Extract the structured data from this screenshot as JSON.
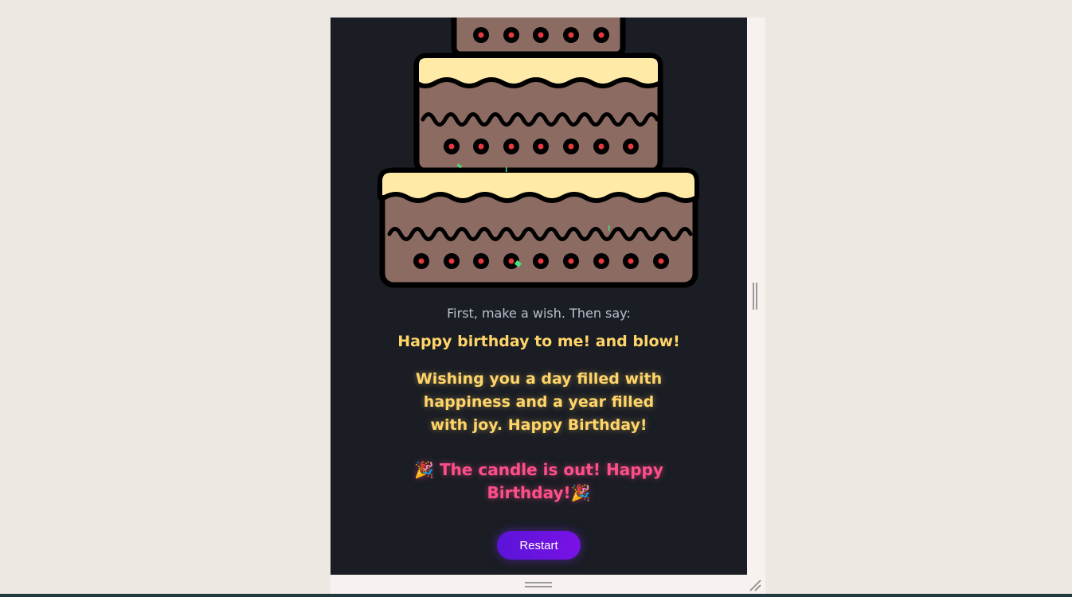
{
  "card": {
    "prompt": "First, make a wish. Then say:",
    "phrase": "Happy birthday to me! and blow!",
    "message": "Wishing you a day filled with happiness and a year filled with joy. Happy Birthday!",
    "status": "🎉 The candle is out! Happy Birthday!🎉",
    "restart_label": "Restart"
  },
  "colors": {
    "page_background": "#ede8e2",
    "card_background": "#1a1d24",
    "cake_body": "#8c6b62",
    "frosting": "#ffeaa7",
    "accent_yellow": "#ffd56a",
    "accent_pink": "#ff4f8b",
    "button": "#6a14e0"
  }
}
